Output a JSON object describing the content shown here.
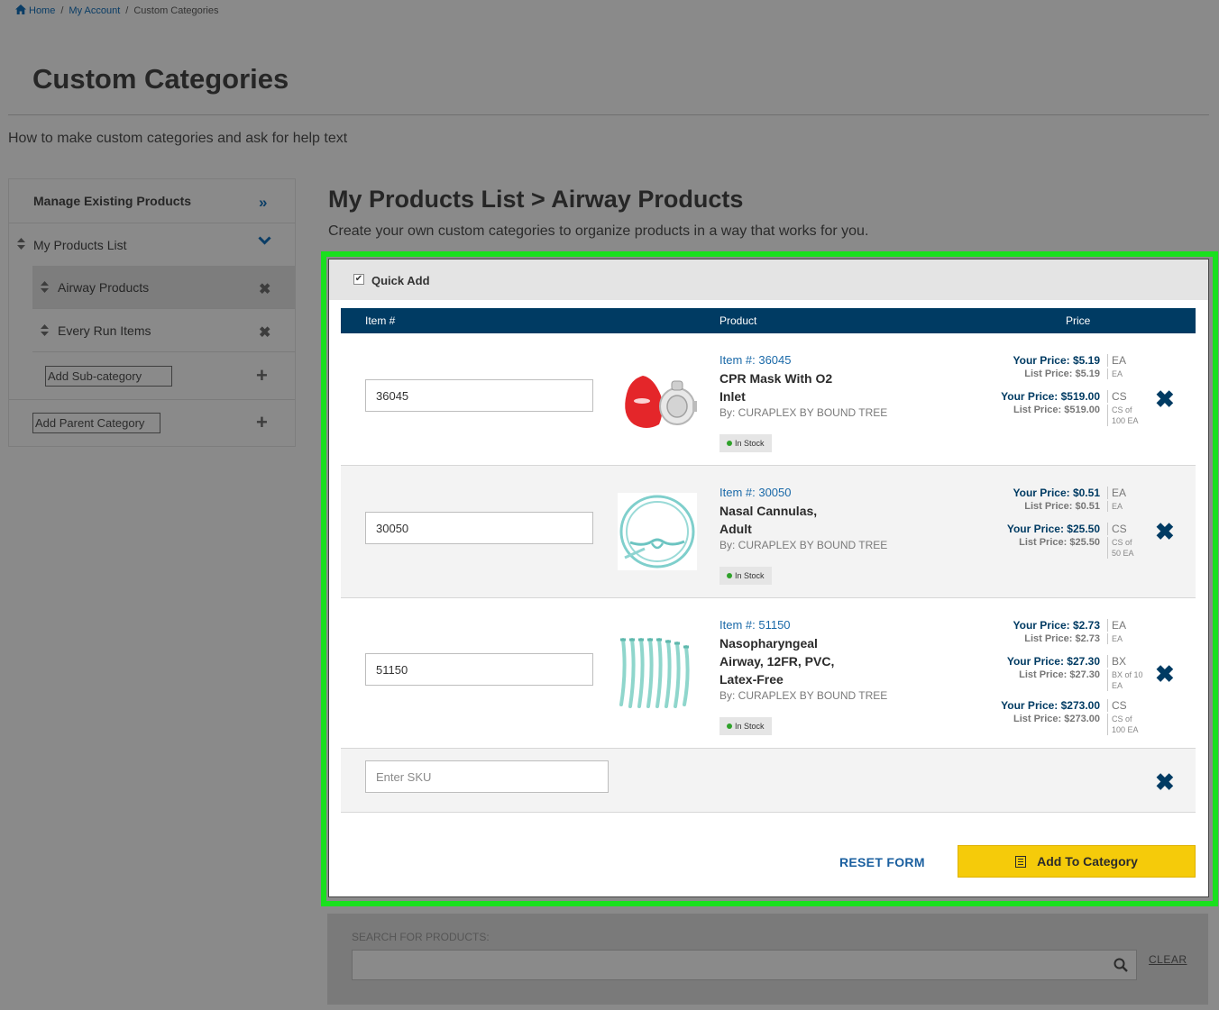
{
  "breadcrumb": {
    "home": "Home",
    "account": "My Account",
    "current": "Custom Categories",
    "sep": "/"
  },
  "page": {
    "title": "Custom Categories",
    "help_text": "How to make custom categories and ask for help text"
  },
  "sidebar": {
    "manage_label": "Manage Existing Products",
    "list_label": "My Products List",
    "sub_items": [
      {
        "label": "Airway Products",
        "active": true
      },
      {
        "label": "Every Run Items",
        "active": false
      }
    ],
    "add_sub_placeholder": "Add Sub-category",
    "add_parent_placeholder": "Add Parent Category"
  },
  "main": {
    "title": "My Products List > Airway Products",
    "description": "Create your own custom categories to organize products in a way that works for you."
  },
  "quick_add": {
    "label": "Quick Add",
    "checked": true,
    "columns": {
      "item": "Item #",
      "product": "Product",
      "price": "Price"
    },
    "rows": [
      {
        "sku": "36045",
        "item_no": "Item #: 36045",
        "name_lines": [
          "CPR Mask With O2",
          "Inlet"
        ],
        "by": "By: CURAPLEX BY BOUND TREE",
        "stock": "In Stock",
        "prices": [
          {
            "your": "Your Price: $5.19",
            "list": "List Price: $5.19",
            "unit": "EA",
            "unit_label": "EA"
          },
          {
            "your": "Your Price: $519.00",
            "list": "List Price: $519.00",
            "unit": "CS",
            "unit_label": "CS of 100 EA"
          }
        ]
      },
      {
        "sku": "30050",
        "item_no": "Item #: 30050",
        "name_lines": [
          "Nasal Cannulas,",
          "Adult"
        ],
        "by": "By: CURAPLEX BY BOUND TREE",
        "stock": "In Stock",
        "prices": [
          {
            "your": "Your Price: $0.51",
            "list": "List Price: $0.51",
            "unit": "EA",
            "unit_label": "EA"
          },
          {
            "your": "Your Price: $25.50",
            "list": "List Price: $25.50",
            "unit": "CS",
            "unit_label": "CS of 50 EA"
          }
        ]
      },
      {
        "sku": "51150",
        "item_no": "Item #: 51150",
        "name_lines": [
          "Nasopharyngeal",
          "Airway, 12FR, PVC,",
          "Latex-Free"
        ],
        "by": "By: CURAPLEX BY BOUND TREE",
        "stock": "In Stock",
        "prices": [
          {
            "your": "Your Price: $2.73",
            "list": "List Price: $2.73",
            "unit": "EA",
            "unit_label": "EA"
          },
          {
            "your": "Your Price: $27.30",
            "list": "List Price: $27.30",
            "unit": "BX",
            "unit_label": "BX of 10 EA"
          },
          {
            "your": "Your Price: $273.00",
            "list": "List Price: $273.00",
            "unit": "CS",
            "unit_label": "CS of 100 EA"
          }
        ]
      }
    ],
    "empty_placeholder": "Enter SKU",
    "reset_label": "RESET FORM",
    "add_label": "Add To Category"
  },
  "search": {
    "label": "SEARCH FOR PRODUCTS:",
    "clear_label": "CLEAR"
  },
  "colors": {
    "accent": "#003b63",
    "link": "#1a69a8",
    "button": "#f5cb0a",
    "highlight": "#19e01e",
    "in_stock": "#2fa12a"
  }
}
